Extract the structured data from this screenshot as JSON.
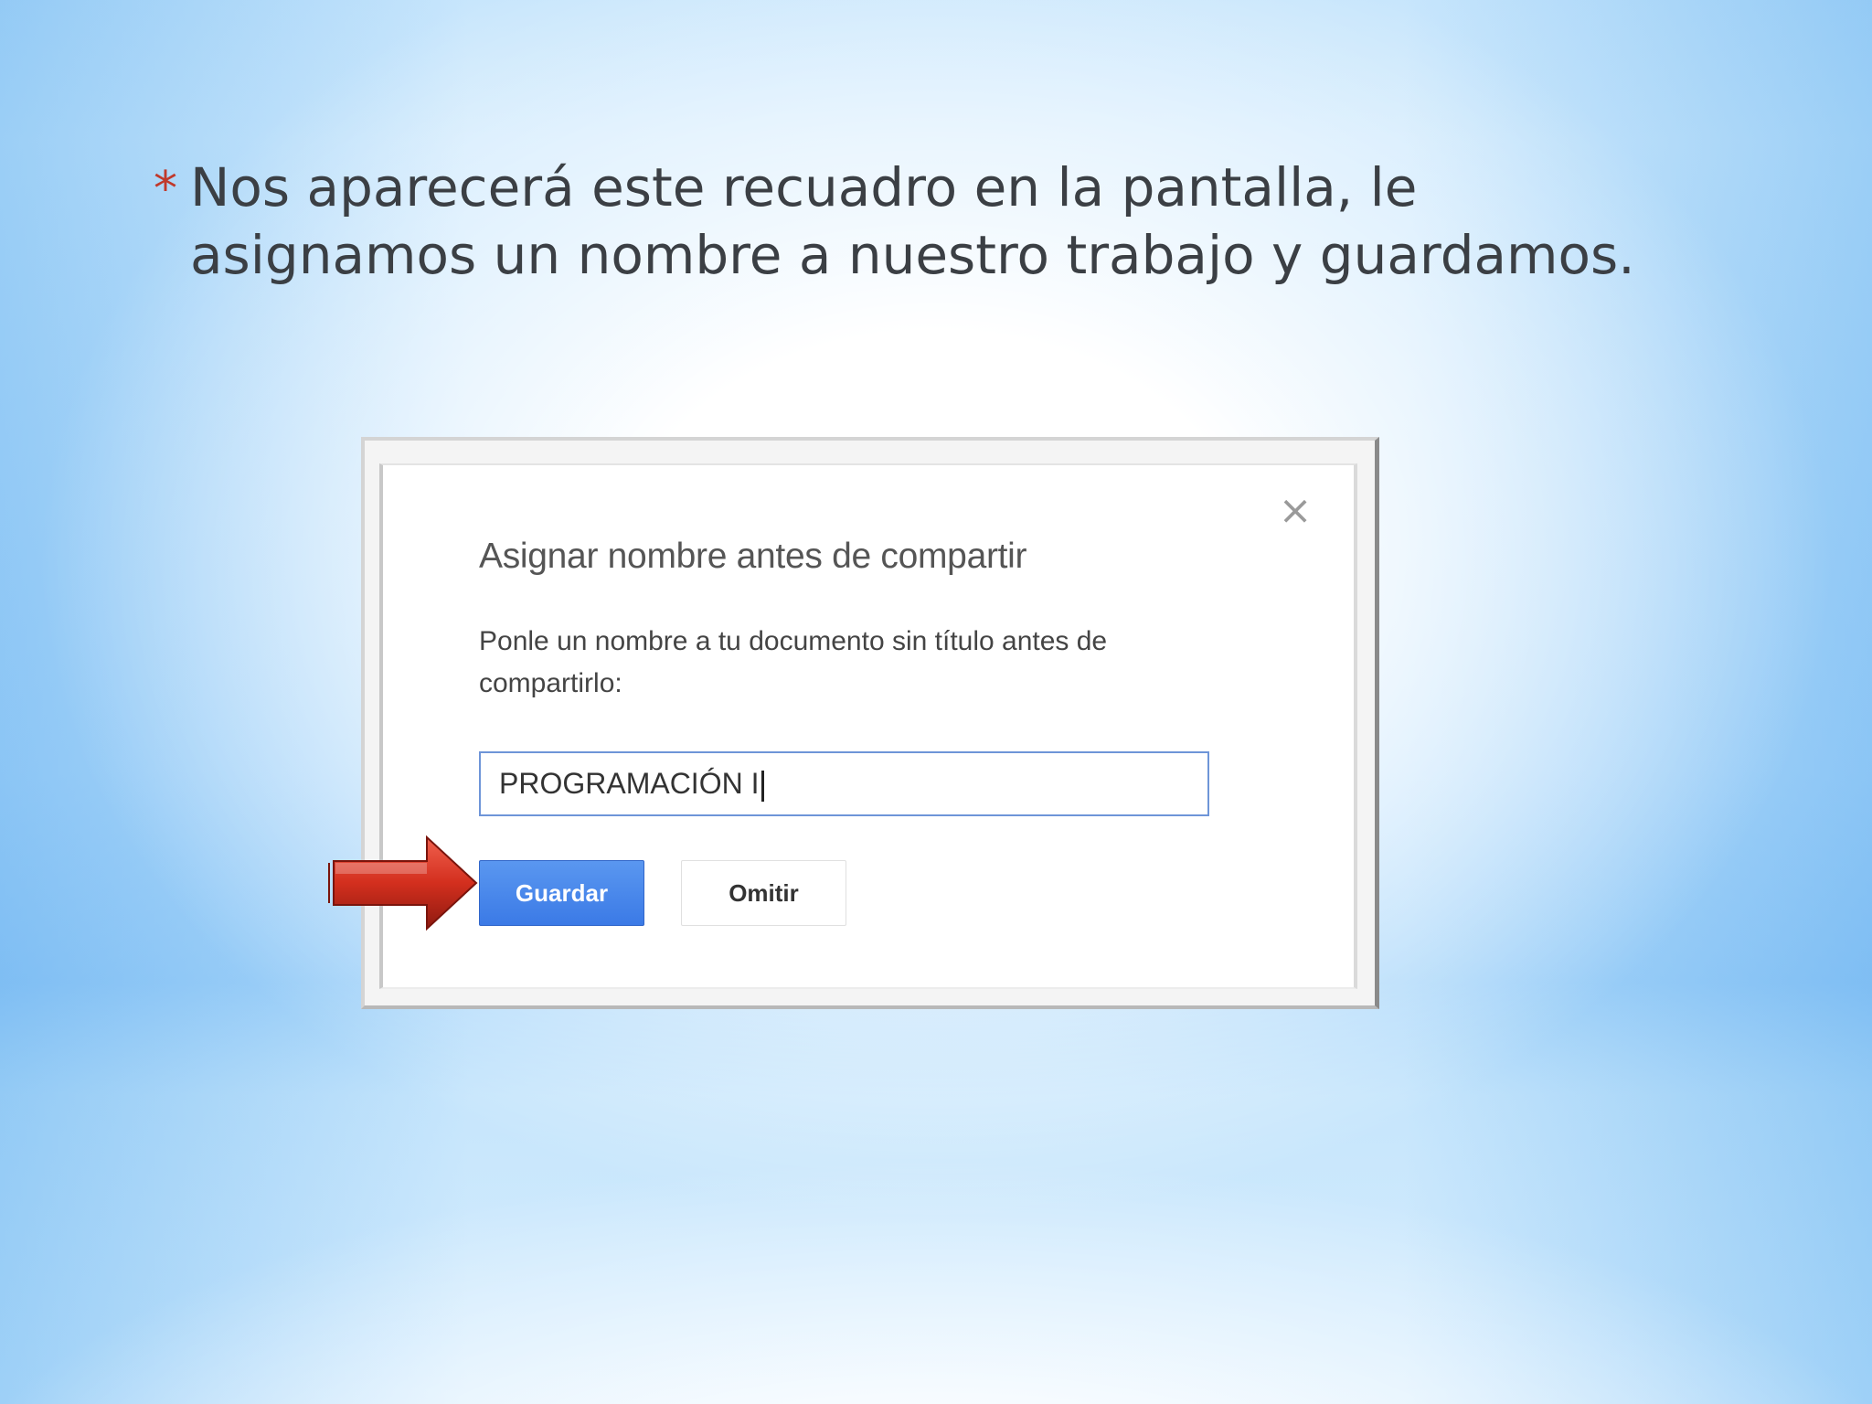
{
  "slide": {
    "bullet_mark": "*",
    "bullet_text": "Nos aparecerá este recuadro en la pantalla, le asignamos un nombre a nuestro trabajo y guardamos."
  },
  "dialog": {
    "close_glyph": "×",
    "title": "Asignar nombre antes de compartir",
    "message": "Ponle un nombre a tu documento sin título antes de compartirlo:",
    "input_value": "PROGRAMACIÓN I",
    "save_label": "Guardar",
    "skip_label": "Omitir"
  },
  "icons": {
    "close": "close-icon",
    "pointer": "red-arrow-icon"
  },
  "colors": {
    "primary_button": "#4285f4",
    "arrow": "#d32f1e",
    "bullet": "#c0392b"
  }
}
